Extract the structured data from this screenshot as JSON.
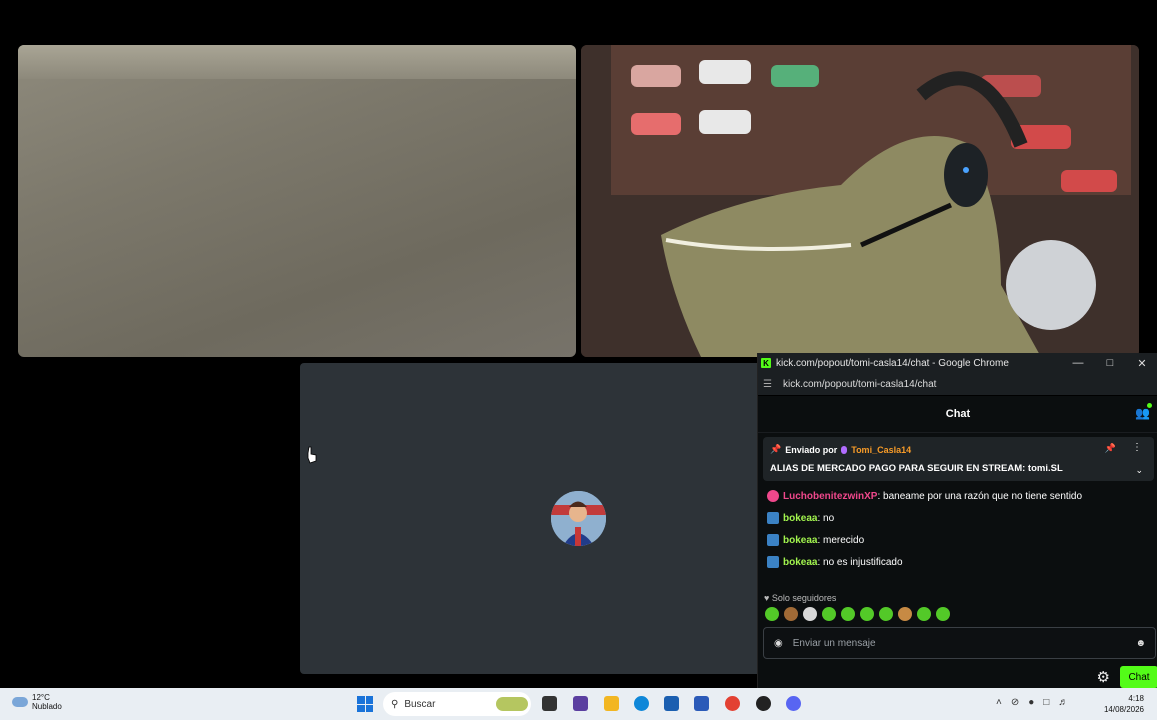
{
  "chat_window": {
    "title": "kick.com/popout/tomi-casla14/chat - Google Chrome",
    "url": "kick.com/popout/tomi-casla14/chat",
    "header": "Chat",
    "pinned": {
      "sent_by_label": "Enviado por",
      "author": "Tomi_Casla14",
      "message": "ALIAS DE MERCADO PAGO PARA SEGUIR EN STREAM: tomi.SL"
    },
    "cut_line": "Luchobenitezwinxp: ...",
    "messages": [
      {
        "user": "LuchobenitezwinXP",
        "text": ": baneame por una razón que no tiene sentido",
        "user_color": "#f0488c",
        "badge": "pink"
      },
      {
        "user": "bokeaa",
        "text": ": no",
        "user_color": "#a2f44e",
        "badge": "blue"
      },
      {
        "user": "bokeaa",
        "text": ": merecido",
        "user_color": "#a2f44e",
        "badge": "blue"
      },
      {
        "user": "bokeaa",
        "text": ": no es injustificado",
        "user_color": "#a2f44e",
        "badge": "blue"
      }
    ],
    "followers_only": "Solo seguidores",
    "input_placeholder": "Enviar un mensaje",
    "chat_button": "Chat"
  },
  "taskbar": {
    "temperature": "12°C",
    "weather": "Nublado",
    "search_placeholder": "Buscar",
    "time": "4:18",
    "date": "14/08/2026"
  },
  "colors": {
    "kick_green": "#53fc18",
    "pinned_author": "#f79b28"
  }
}
